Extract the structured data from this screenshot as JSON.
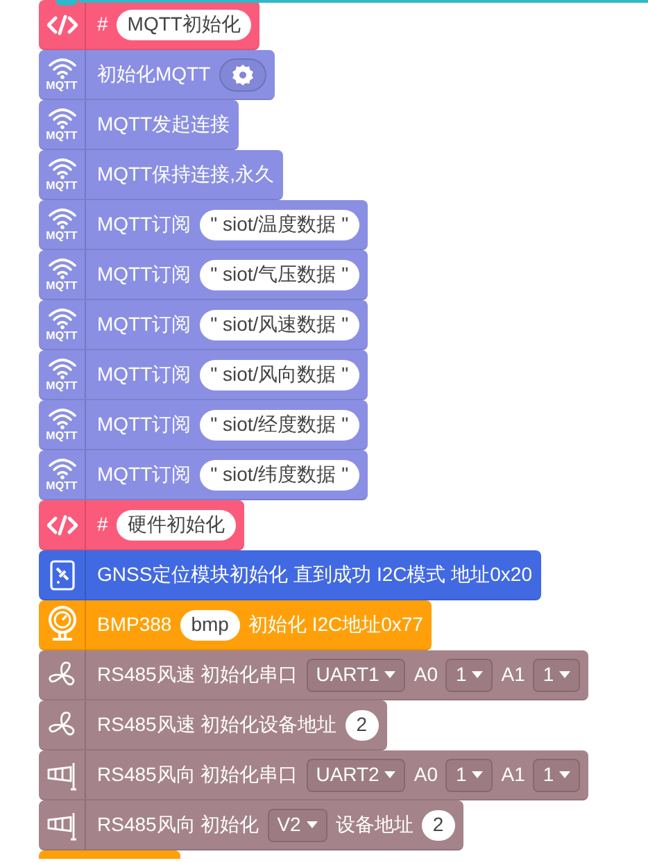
{
  "blocks": [
    {
      "kind": "code",
      "color": "#fb5b7b",
      "parts": [
        {
          "kind": "text",
          "text": "#"
        },
        {
          "kind": "pill",
          "text": "MQTT初始化"
        }
      ]
    },
    {
      "kind": "wifi",
      "icon_label": "MQTT",
      "color": "#8a8fe3",
      "parts": [
        {
          "kind": "text",
          "text": "初始化MQTT"
        },
        {
          "kind": "gear"
        }
      ]
    },
    {
      "kind": "wifi",
      "icon_label": "MQTT",
      "color": "#8a8fe3",
      "parts": [
        {
          "kind": "text",
          "text": "MQTT发起连接"
        }
      ]
    },
    {
      "kind": "wifi",
      "icon_label": "MQTT",
      "color": "#8a8fe3",
      "parts": [
        {
          "kind": "text",
          "text": "MQTT保持连接,永久"
        }
      ]
    },
    {
      "kind": "wifi",
      "icon_label": "MQTT",
      "color": "#8a8fe3",
      "parts": [
        {
          "kind": "text",
          "text": "MQTT订阅"
        },
        {
          "kind": "pill",
          "text": "\" siot/温度数据 \""
        }
      ]
    },
    {
      "kind": "wifi",
      "icon_label": "MQTT",
      "color": "#8a8fe3",
      "parts": [
        {
          "kind": "text",
          "text": "MQTT订阅"
        },
        {
          "kind": "pill",
          "text": "\" siot/气压数据 \""
        }
      ]
    },
    {
      "kind": "wifi",
      "icon_label": "MQTT",
      "color": "#8a8fe3",
      "parts": [
        {
          "kind": "text",
          "text": "MQTT订阅"
        },
        {
          "kind": "pill",
          "text": "\" siot/风速数据 \""
        }
      ]
    },
    {
      "kind": "wifi",
      "icon_label": "MQTT",
      "color": "#8a8fe3",
      "parts": [
        {
          "kind": "text",
          "text": "MQTT订阅"
        },
        {
          "kind": "pill",
          "text": "\" siot/风向数据 \""
        }
      ]
    },
    {
      "kind": "wifi",
      "icon_label": "MQTT",
      "color": "#8a8fe3",
      "parts": [
        {
          "kind": "text",
          "text": "MQTT订阅"
        },
        {
          "kind": "pill",
          "text": "\" siot/经度数据 \""
        }
      ]
    },
    {
      "kind": "wifi",
      "icon_label": "MQTT",
      "color": "#8a8fe3",
      "parts": [
        {
          "kind": "text",
          "text": "MQTT订阅"
        },
        {
          "kind": "pill",
          "text": "\" siot/纬度数据 \""
        }
      ]
    },
    {
      "kind": "code",
      "color": "#fb5b7b",
      "parts": [
        {
          "kind": "text",
          "text": "#"
        },
        {
          "kind": "pill",
          "text": "硬件初始化"
        }
      ]
    },
    {
      "kind": "satellite",
      "color": "#4169e1",
      "parts": [
        {
          "kind": "text",
          "text": "GNSS定位模块初始化 直到成功 I2C模式 地址0x20"
        }
      ]
    },
    {
      "kind": "gauge",
      "color": "#ffa00a",
      "parts": [
        {
          "kind": "text",
          "text": "BMP388"
        },
        {
          "kind": "pill",
          "text": "bmp"
        },
        {
          "kind": "text",
          "text": "初始化 I2C地址0x77"
        }
      ]
    },
    {
      "kind": "fan",
      "color": "#a5838a",
      "parts": [
        {
          "kind": "text",
          "text": "RS485风速 初始化串口"
        },
        {
          "kind": "dropdown",
          "text": "UART1"
        },
        {
          "kind": "text",
          "text": "A0"
        },
        {
          "kind": "dropdown",
          "text": "1"
        },
        {
          "kind": "text",
          "text": "A1"
        },
        {
          "kind": "dropdown",
          "text": "1"
        }
      ]
    },
    {
      "kind": "fan",
      "color": "#a5838a",
      "parts": [
        {
          "kind": "text",
          "text": "RS485风速 初始化设备地址"
        },
        {
          "kind": "pill",
          "text": "2"
        }
      ]
    },
    {
      "kind": "windsock",
      "color": "#a5838a",
      "parts": [
        {
          "kind": "text",
          "text": "RS485风向 初始化串口"
        },
        {
          "kind": "dropdown",
          "text": "UART2"
        },
        {
          "kind": "text",
          "text": "A0"
        },
        {
          "kind": "dropdown",
          "text": "1"
        },
        {
          "kind": "text",
          "text": "A1"
        },
        {
          "kind": "dropdown",
          "text": "1"
        }
      ]
    },
    {
      "kind": "windsock",
      "color": "#a5838a",
      "parts": [
        {
          "kind": "text",
          "text": "RS485风向 初始化"
        },
        {
          "kind": "dropdown",
          "text": "V2"
        },
        {
          "kind": "text",
          "text": "设备地址"
        },
        {
          "kind": "pill",
          "text": "2"
        }
      ]
    }
  ]
}
